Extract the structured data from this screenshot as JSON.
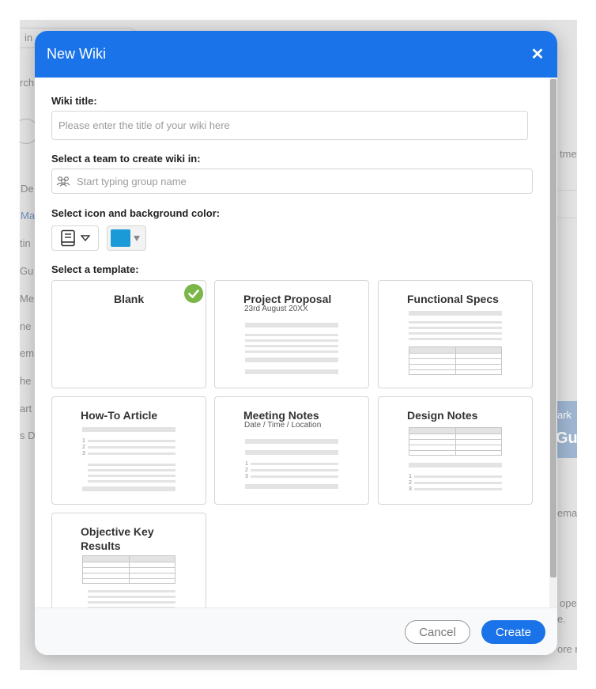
{
  "modal": {
    "title": "New Wiki",
    "close_icon": "close-icon"
  },
  "form": {
    "wiki_title_label": "Wiki title:",
    "wiki_title_placeholder": "Please enter the title of your wiki here",
    "wiki_title_value": "",
    "team_label": "Select a team to create wiki in:",
    "team_placeholder": "Start typing group name",
    "team_value": "",
    "icon_color_label": "Select icon and background color:",
    "selected_icon": "book-icon",
    "selected_color": "#1a9ad6",
    "template_label": "Select a template:"
  },
  "templates": [
    {
      "id": "blank",
      "title": "Blank",
      "subtitle": "",
      "selected": true
    },
    {
      "id": "project-proposal",
      "title": "Project Proposal",
      "subtitle": "23rd August 20XX",
      "selected": false
    },
    {
      "id": "functional-specs",
      "title": "Functional Specs",
      "subtitle": "",
      "selected": false
    },
    {
      "id": "how-to-article",
      "title": "How-To Article",
      "subtitle": "",
      "selected": false
    },
    {
      "id": "meeting-notes",
      "title": "Meeting Notes",
      "subtitle": "Date / Time / Location",
      "selected": false
    },
    {
      "id": "design-notes",
      "title": "Design Notes",
      "subtitle": "",
      "selected": false
    },
    {
      "id": "okr",
      "title": "Objective Key Results",
      "subtitle": "",
      "selected": false
    }
  ],
  "footer": {
    "cancel_label": "Cancel",
    "create_label": "Create"
  },
  "background_fragments": [
    "in",
    "rch",
    "De",
    "Ma",
    "tin",
    "Gu",
    "Me",
    "ne",
    "em",
    "he",
    "art",
    "s D",
    "tme",
    "ark",
    "Gu",
    "ema",
    "ope",
    "e.",
    "ore r"
  ],
  "colors": {
    "header": "#1a73e8",
    "primary_button": "#1a73e8",
    "selected_check": "#7ab648"
  }
}
